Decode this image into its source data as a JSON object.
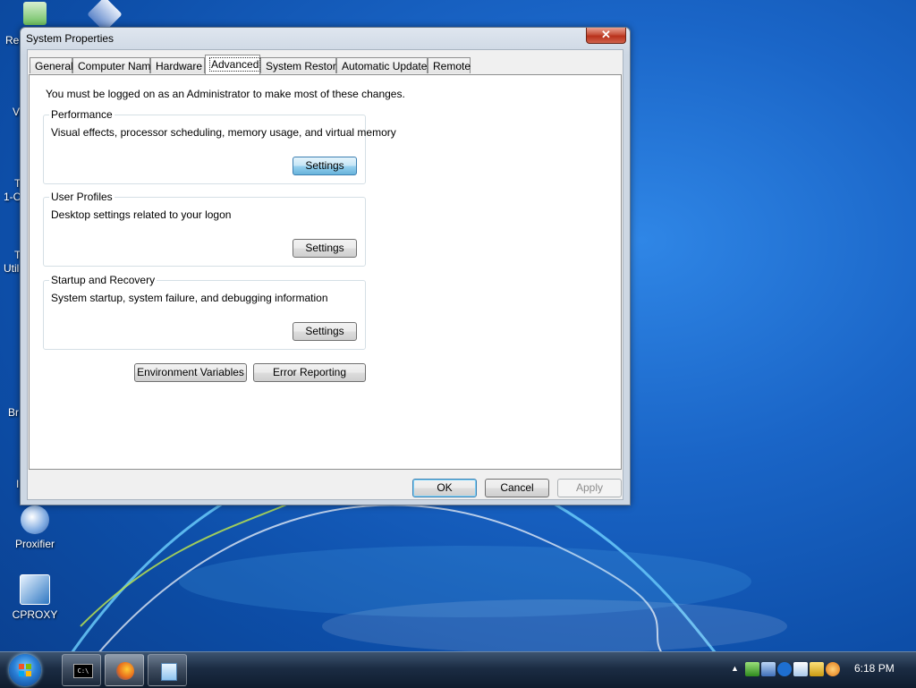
{
  "desktop": {
    "icons": [
      {
        "name": "Proxifier",
        "label": "Proxifier"
      },
      {
        "name": "CPROXY",
        "label": "CPROXY"
      }
    ],
    "partial_labels": [
      "Re",
      "V",
      "T",
      "1-C",
      "T",
      "Util",
      "Br",
      "I"
    ]
  },
  "window": {
    "title": "System Properties",
    "close_glyph": "✕",
    "tabs": [
      {
        "label": "General"
      },
      {
        "label": "Computer Name"
      },
      {
        "label": "Hardware"
      },
      {
        "label": "Advanced",
        "selected": true
      },
      {
        "label": "System Restore"
      },
      {
        "label": "Automatic Updates"
      },
      {
        "label": "Remote"
      }
    ],
    "notice": "You must be logged on as an Administrator to make most of these changes.",
    "groups": {
      "performance": {
        "title": "Performance",
        "description": "Visual effects, processor scheduling, memory usage, and virtual memory",
        "button": "Settings"
      },
      "user_profiles": {
        "title": "User Profiles",
        "description": "Desktop settings related to your logon",
        "button": "Settings"
      },
      "startup_recovery": {
        "title": "Startup and Recovery",
        "description": "System startup, system failure, and debugging information",
        "button": "Settings"
      }
    },
    "env_vars_button": "Environment Variables",
    "error_reporting_button": "Error Reporting",
    "ok_button": "OK",
    "cancel_button": "Cancel",
    "apply_button": "Apply"
  },
  "taskbar": {
    "apps": [
      {
        "name": "command-prompt",
        "label": "C:\\"
      },
      {
        "name": "firefox"
      },
      {
        "name": "notepad"
      }
    ],
    "tray_arrow": "▲",
    "clock": "6:18 PM"
  },
  "colors": {
    "accent": "#3c7fb1",
    "desktop": "#1a65c7"
  }
}
